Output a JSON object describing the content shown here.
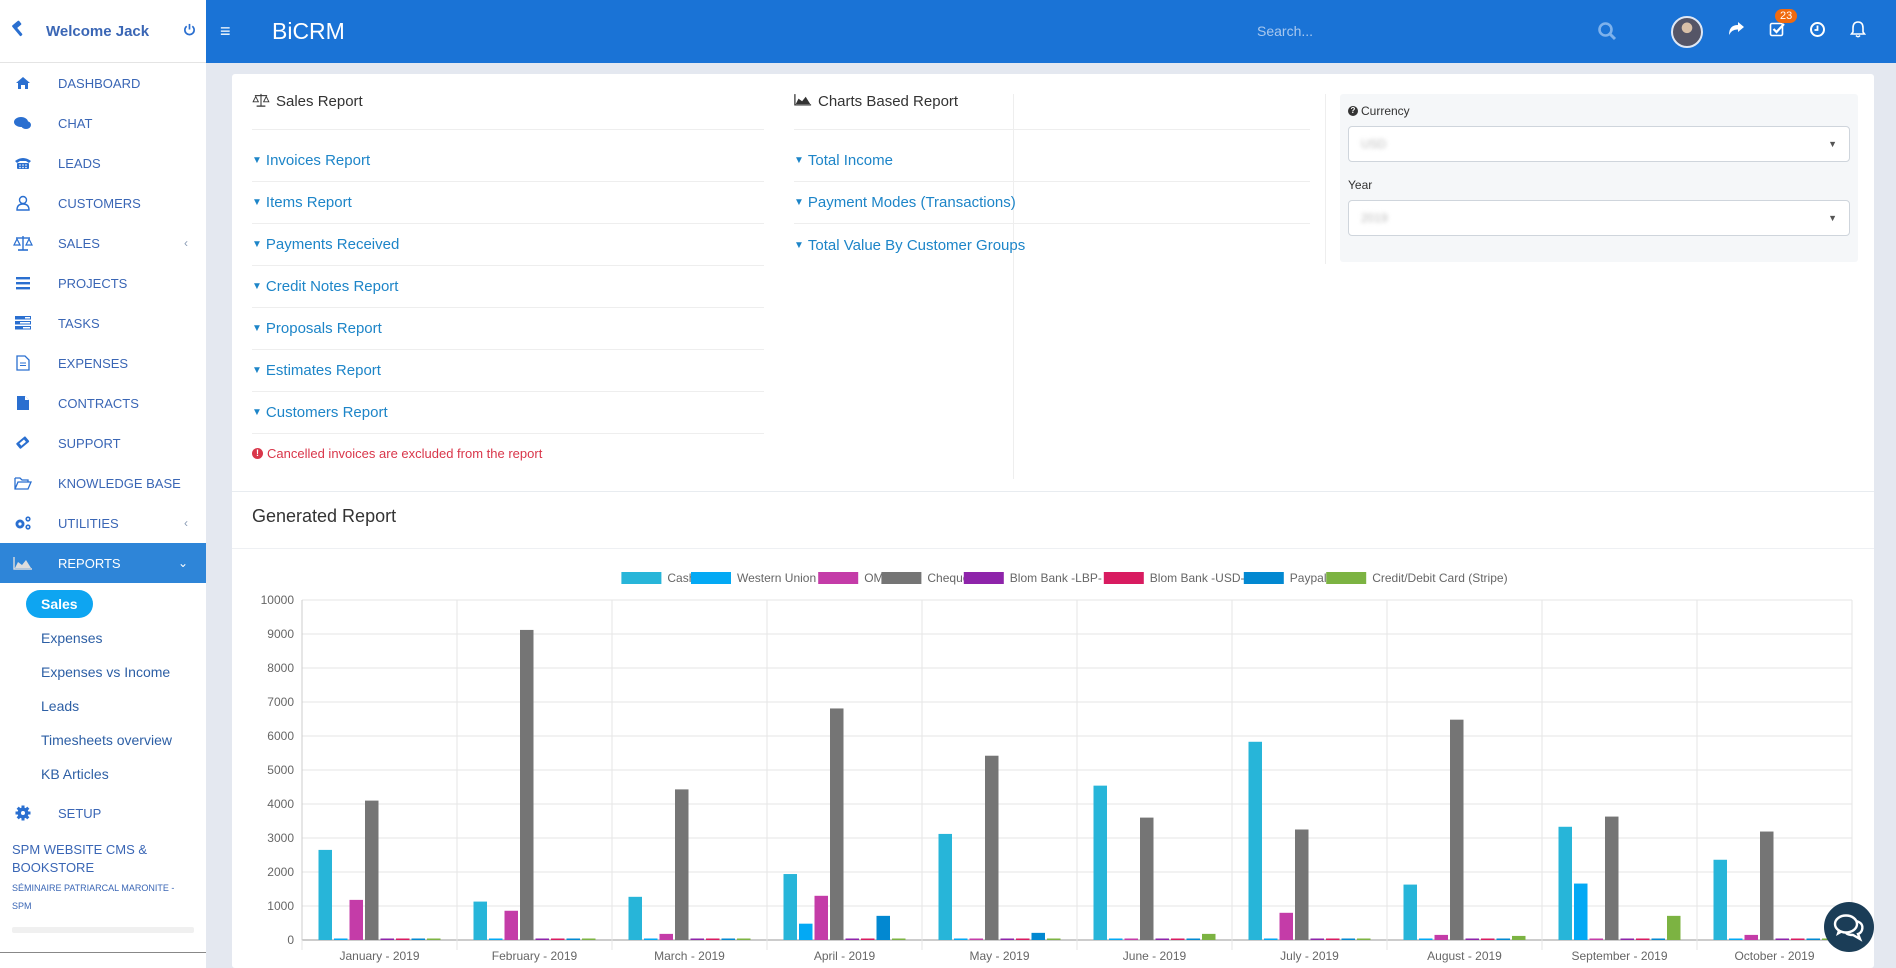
{
  "sidebar": {
    "welcome": "Welcome Jack",
    "items": [
      {
        "label": "DASHBOARD",
        "icon": "home-icon"
      },
      {
        "label": "CHAT",
        "icon": "chat-icon"
      },
      {
        "label": "LEADS",
        "icon": "phone-icon"
      },
      {
        "label": "CUSTOMERS",
        "icon": "user-icon"
      },
      {
        "label": "SALES",
        "icon": "balance-scale-icon",
        "caret": "‹"
      },
      {
        "label": "PROJECTS",
        "icon": "bars-icon"
      },
      {
        "label": "TASKS",
        "icon": "tasks-icon"
      },
      {
        "label": "EXPENSES",
        "icon": "file-text-icon"
      },
      {
        "label": "CONTRACTS",
        "icon": "file-icon"
      },
      {
        "label": "SUPPORT",
        "icon": "ticket-icon"
      },
      {
        "label": "KNOWLEDGE BASE",
        "icon": "folder-open-icon"
      },
      {
        "label": "UTILITIES",
        "icon": "cogs-icon",
        "caret": "‹"
      },
      {
        "label": "REPORTS",
        "icon": "area-chart-icon",
        "caret": "⌄"
      }
    ],
    "reports_sub": [
      "Sales",
      "Expenses",
      "Expenses vs Income",
      "Leads",
      "Timesheets overview",
      "KB Articles"
    ],
    "setup": "SETUP",
    "company_name": "SPM WEBSITE CMS & BOOKSTORE",
    "company_sub": "SÉMINAIRE PATRIARCAL MARONITE - SPM"
  },
  "topbar": {
    "brand": "BiCRM",
    "search_placeholder": "Search...",
    "tasks_badge": "23"
  },
  "sales_report": {
    "title": "Sales Report",
    "links": [
      "Invoices Report",
      "Items Report",
      "Payments Received",
      "Credit Notes Report",
      "Proposals Report",
      "Estimates Report",
      "Customers Report"
    ],
    "warning": "Cancelled invoices are excluded from the report"
  },
  "charts_report": {
    "title": "Charts Based Report",
    "links": [
      "Total Income",
      "Payment Modes (Transactions)",
      "Total Value By Customer Groups"
    ]
  },
  "filters": {
    "currency_label": "Currency",
    "currency_value": "USD",
    "year_label": "Year",
    "year_value": "2019"
  },
  "generated_report": {
    "title": "Generated Report"
  },
  "chart_data": {
    "type": "bar",
    "title": "",
    "xlabel": "",
    "ylabel": "",
    "ylim": [
      0,
      10000
    ],
    "yticks": [
      0,
      1000,
      2000,
      3000,
      4000,
      5000,
      6000,
      7000,
      8000,
      9000,
      10000
    ],
    "grid": true,
    "legend": "top-center",
    "categories": [
      "January - 2019",
      "February - 2019",
      "March - 2019",
      "April - 2019",
      "May - 2019",
      "June - 2019",
      "July - 2019",
      "August - 2019",
      "September - 2019",
      "October - 2019"
    ],
    "series": [
      {
        "name": "Cash",
        "color": "#27b5d9",
        "values": [
          2650,
          1130,
          1270,
          1940,
          3120,
          4540,
          5830,
          1630,
          3330,
          2360
        ]
      },
      {
        "name": "Western Union",
        "color": "#03a9f4",
        "values": [
          0,
          0,
          0,
          480,
          0,
          0,
          0,
          0,
          1660,
          0
        ]
      },
      {
        "name": "OMT",
        "color": "#c43ca8",
        "values": [
          1180,
          860,
          180,
          1300,
          0,
          0,
          800,
          150,
          0,
          150
        ]
      },
      {
        "name": "Cheque",
        "color": "#757575",
        "values": [
          4100,
          9120,
          4430,
          6810,
          5420,
          3600,
          3250,
          6480,
          3630,
          3190
        ]
      },
      {
        "name": "Blom Bank -LBP-",
        "color": "#8e24aa",
        "values": [
          0,
          0,
          0,
          0,
          0,
          0,
          0,
          0,
          0,
          0
        ]
      },
      {
        "name": "Blom Bank -USD-",
        "color": "#d81b60",
        "values": [
          0,
          0,
          0,
          0,
          0,
          0,
          0,
          0,
          0,
          0
        ]
      },
      {
        "name": "Paypal",
        "color": "#0288d1",
        "values": [
          0,
          0,
          0,
          710,
          210,
          0,
          0,
          0,
          0,
          0
        ]
      },
      {
        "name": "Credit/Debit Card (Stripe)",
        "color": "#7cb342",
        "values": [
          0,
          0,
          0,
          0,
          0,
          180,
          0,
          120,
          710,
          0
        ]
      }
    ]
  }
}
